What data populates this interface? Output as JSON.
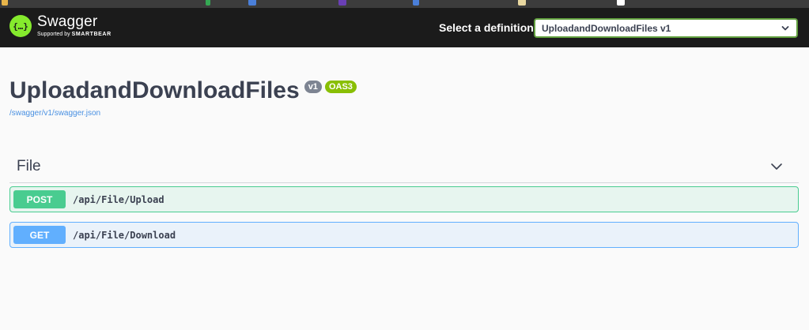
{
  "topbar": {
    "logo_title": "Swagger",
    "logo_supported_by": "Supported by",
    "logo_brand": "SMARTBEAR",
    "definition_label": "Select a definition",
    "definition_selected": "UploadandDownloadFiles v1"
  },
  "info": {
    "title": "UploadandDownloadFiles",
    "version_badge": "v1",
    "oas_badge": "OAS3",
    "spec_url": "/swagger/v1/swagger.json"
  },
  "tag": {
    "name": "File",
    "operations": [
      {
        "method": "POST",
        "path": "/api/File/Upload"
      },
      {
        "method": "GET",
        "path": "/api/File/Download"
      }
    ]
  },
  "colors": {
    "topbar_bg": "#1b1b1b",
    "logo_green": "#85ea2d",
    "select_border": "#62a03f",
    "post": "#49cc90",
    "get": "#61affe",
    "version_badge": "#7d8492",
    "oas_badge": "#89bf04",
    "link": "#4990e2"
  }
}
